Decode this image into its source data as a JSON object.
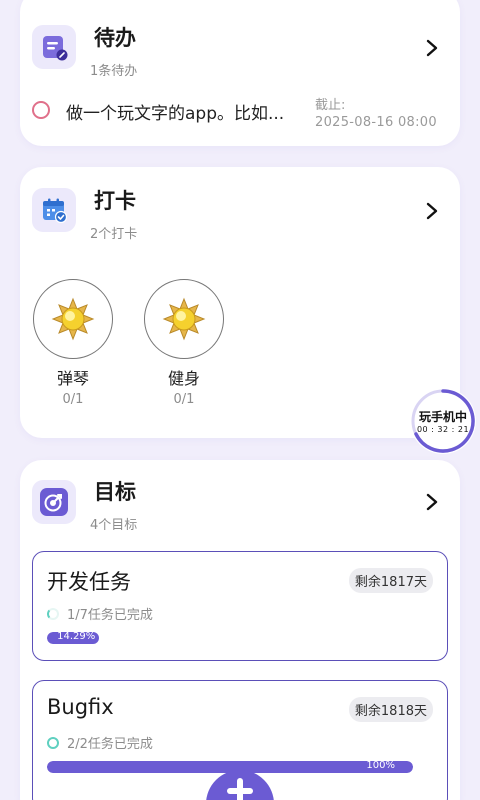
{
  "todo": {
    "title": "待办",
    "subtitle": "1条待办",
    "icon": "memo-icon",
    "items": [
      {
        "text": "做一个玩文字的app。比如...",
        "deadline_label": "截止:",
        "deadline": "2025-08-16  08:00"
      }
    ]
  },
  "checkin": {
    "title": "打卡",
    "subtitle": "2个打卡",
    "icon": "calendar-check-icon",
    "habits": [
      {
        "name": "弹琴",
        "count": "0/1",
        "icon": "sun-icon"
      },
      {
        "name": "健身",
        "count": "0/1",
        "icon": "sun-icon"
      }
    ]
  },
  "goals": {
    "title": "目标",
    "subtitle": "4个目标",
    "icon": "target-icon",
    "items": [
      {
        "title": "开发任务",
        "remaining": "剩余1817天",
        "status": "1/7任务已完成",
        "progress_label": "14.29%",
        "progress": 0.1429
      },
      {
        "title": "Bugfix",
        "remaining": "剩余1818天",
        "status": "2/2任务已完成",
        "progress_label": "100%",
        "progress": 1.0
      }
    ]
  },
  "timer": {
    "label": "玩手机中",
    "time": "00 : 32 : 21"
  },
  "colors": {
    "accent": "#6b5bd3",
    "todo_ring": "#e0708a",
    "background": "#f1eefb"
  }
}
